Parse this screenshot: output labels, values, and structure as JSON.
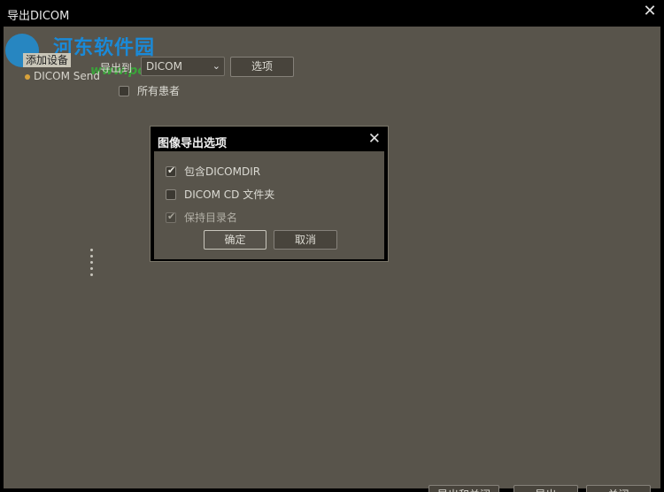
{
  "window": {
    "title": "导出DICOM",
    "close_glyph": "✕"
  },
  "watermark": {
    "brand": "河东软件园",
    "url": "www.pc0359.cn"
  },
  "device_panel": {
    "tab_label": "添加设备",
    "item_label": "DICOM Send"
  },
  "export": {
    "label": "导出到",
    "selected": "DICOM",
    "options_button": "选项"
  },
  "all_patients": {
    "label": "所有患者",
    "checked": false
  },
  "dialog": {
    "title": "图像导出选项",
    "close_glyph": "✕",
    "options": [
      {
        "label": "包含DICOMDIR",
        "checked": true,
        "enabled": true
      },
      {
        "label": "DICOM CD 文件夹",
        "checked": false,
        "enabled": true
      },
      {
        "label": "保持目录名",
        "checked": true,
        "enabled": false
      }
    ],
    "ok_button": "确定",
    "cancel_button": "取消"
  },
  "footer": {
    "export_and_close": "导出和关闭",
    "export": "导出",
    "close": "关闭"
  },
  "colors": {
    "panel_bg": "#58544b",
    "frame_bg": "#000000",
    "watermark_blue": "#1a8ad8",
    "watermark_green": "#3aa33a"
  },
  "icons": {
    "title_close": "close-icon",
    "dialog_close": "close-icon",
    "select": "chevron-down-icon",
    "splitter": "drag-handle-icon"
  }
}
